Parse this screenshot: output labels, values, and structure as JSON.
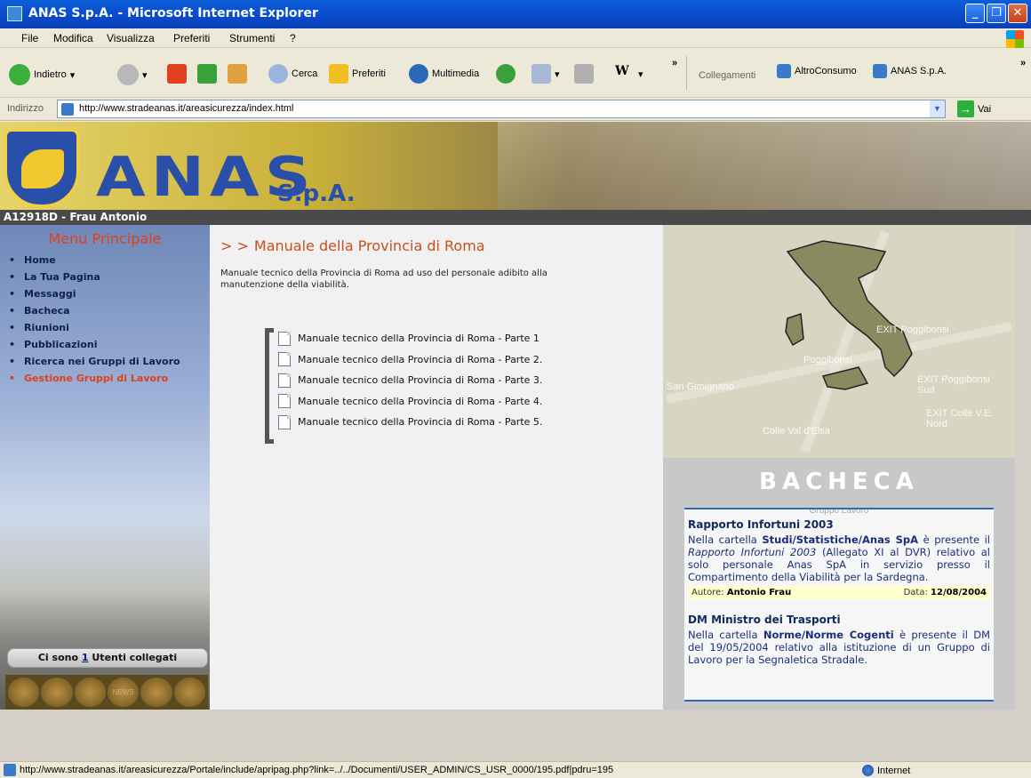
{
  "window": {
    "title": "ANAS S.p.A. - Microsoft Internet Explorer",
    "controls": {
      "minimize": "_",
      "maximize": "❐",
      "close": "✕"
    }
  },
  "menubar": [
    "File",
    "Modifica",
    "Visualizza",
    "Preferiti",
    "Strumenti",
    "?"
  ],
  "toolbar": {
    "back": "Indietro",
    "search": "Cerca",
    "favorites": "Preferiti",
    "multimedia": "Multimedia",
    "overflow": "»",
    "links_label": "Collegamenti",
    "link_1": "AltroConsumo",
    "link_2": "ANAS S.p.A.",
    "links_overflow": "»"
  },
  "address": {
    "label": "Indirizzo",
    "url": "http://www.stradeanas.it/areasicurezza/index.html",
    "go": "Vai"
  },
  "page": {
    "logo": {
      "name": "ANAS",
      "suffix": "S.p.A."
    },
    "user": "A12918D - Frau Antonio",
    "menu": {
      "title": "Menu Principale",
      "items": [
        {
          "label": "Home",
          "active": false
        },
        {
          "label": "La Tua Pagina",
          "active": false
        },
        {
          "label": "Messaggi",
          "active": false
        },
        {
          "label": "Bacheca",
          "active": false
        },
        {
          "label": "Riunioni",
          "active": false
        },
        {
          "label": "Pubblicazioni",
          "active": false
        },
        {
          "label": "Ricerca nei Gruppi di Lavoro",
          "active": false
        },
        {
          "label": "Gestione Gruppi di Lavoro",
          "active": true
        }
      ]
    },
    "users_online": {
      "prefix": "Ci sono",
      "count": "1",
      "suffix": "Utenti collegati"
    },
    "icons_strip_label": "NEWS",
    "content": {
      "title": "Manuale della Provincia di Roma",
      "description": "Manuale tecnico della Provincia di Roma ad uso del personale adibito alla manutenzione della viabilità.",
      "documents": [
        "Manuale tecnico della Provincia di Roma - Parte 1",
        "Manuale tecnico della Provincia di Roma - Parte 2.",
        "Manuale tecnico della Provincia di Roma - Parte 3.",
        "Manuale tecnico della Provincia di Roma - Parte 4.",
        "Manuale tecnico della Provincia di Roma - Parte 5."
      ]
    },
    "map_labels": {
      "poggibonsi": "Poggibonsi",
      "san_gimignano": "San Gimignano",
      "exit_poggibonsi_sud": "EXIT Poggibonsi Sud",
      "exit_colle": "EXIT Colle V.E. Nord",
      "colle_val_d_elsa": "Colle Val d'Elsa",
      "exit_poggibonsi": "EXIT Poggibonsi"
    },
    "bacheca": {
      "title": "BACHECA",
      "faint_header": "Gruppo Lavoro",
      "items": [
        {
          "heading": "Rapporto Infortuni 2003",
          "text_1": "Nella cartella ",
          "bold_1": "Studi/Statistiche/Anas SpA",
          "text_2": " è presente il ",
          "italic_1": "Rapporto Infortuni 2003",
          "text_3": " (Allegato XI al DVR) relativo al solo personale Anas SpA in servizio presso il Compartimento della Viabilità per la Sardegna.",
          "author_label": "Autore:",
          "author": "Antonio Frau",
          "date_label": "Data:",
          "date": "12/08/2004"
        },
        {
          "heading": "DM Ministro dei Trasporti",
          "text_1": "Nella cartella ",
          "bold_1": "Norme/Norme Cogenti",
          "text_2": " è presente il DM del 19/05/2004 relativo alla istituzione di un Gruppo di Lavoro per la Segnaletica Stradale."
        }
      ]
    }
  },
  "statusbar": {
    "url": "http://www.stradeanas.it/areasicurezza/Portale/include/apripag.php?link=../../Documenti/USER_ADMIN/CS_USR_0000/195.pdf|pdru=195",
    "zone": "Internet"
  }
}
